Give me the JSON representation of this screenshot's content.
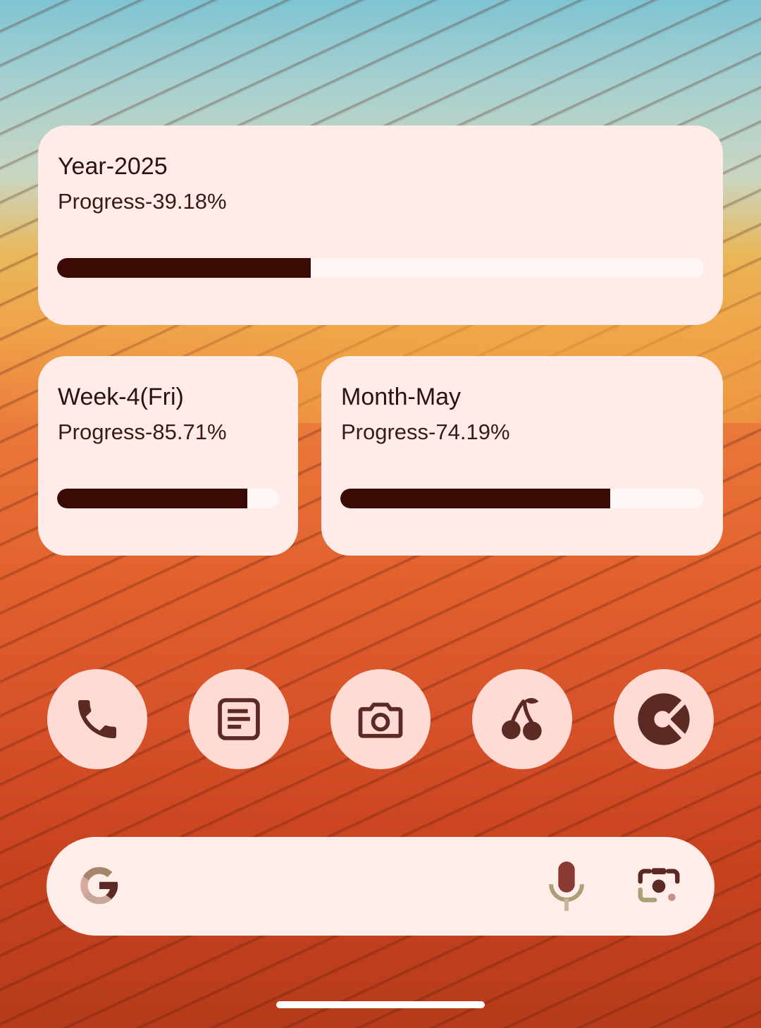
{
  "widgets": {
    "year": {
      "title": "Year-2025",
      "progress_label": "Progress-39.18%",
      "progress": 0.3918
    },
    "week": {
      "title": "Week-4(Fri)",
      "progress_label": "Progress-85.71%",
      "progress": 0.8571
    },
    "month": {
      "title": "Month-May",
      "progress_label": "Progress-74.19%",
      "progress": 0.7419
    }
  },
  "dock": {
    "apps": [
      {
        "name": "phone-icon"
      },
      {
        "name": "notes-icon"
      },
      {
        "name": "camera-icon"
      },
      {
        "name": "cherry-icon"
      },
      {
        "name": "app-logo-icon"
      }
    ]
  },
  "search_bar": {
    "icons": [
      "google-g-icon",
      "microphone-icon",
      "lens-icon"
    ]
  },
  "colors": {
    "card_bg": "#ffece8",
    "bar_fill": "#3a0a05",
    "bar_track": "#fff6f6",
    "icon_bg": "#ffdbd3",
    "icon_fg": "#5c2a24"
  }
}
